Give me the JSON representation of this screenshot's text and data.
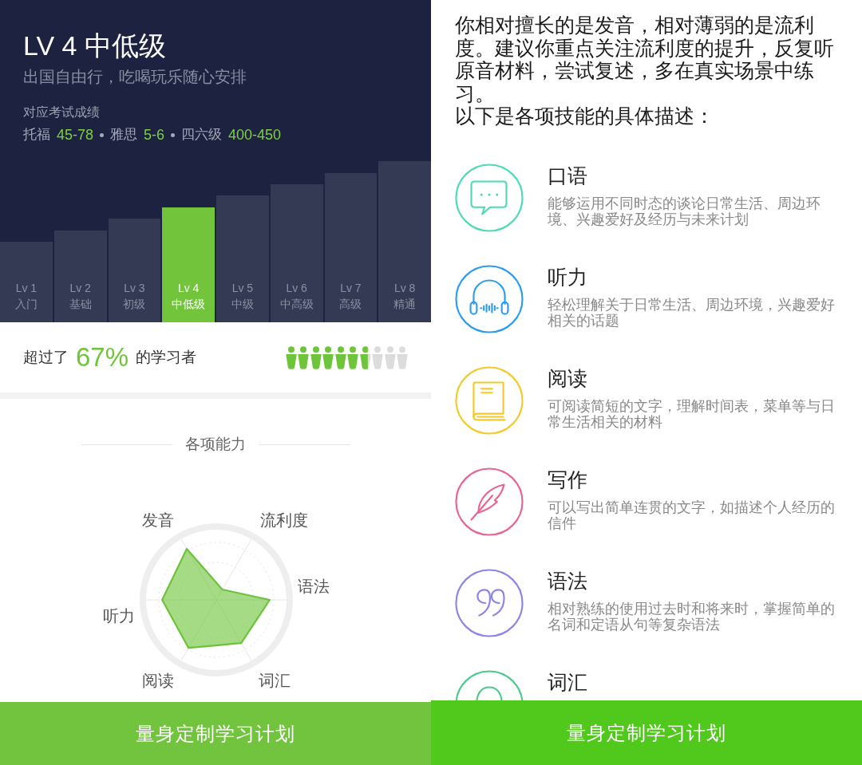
{
  "left": {
    "header": {
      "title": "LV 4 中低级",
      "subtitle": "出国自由行，吃喝玩乐随心安排",
      "exam_label": "对应考试成绩",
      "exam_scores": [
        {
          "exam": "托福",
          "score": "45-78"
        },
        {
          "exam": "雅思",
          "score": "5-6"
        },
        {
          "exam": "四六级",
          "score": "400-450"
        }
      ]
    },
    "levels": [
      {
        "label": "Lv 1",
        "name": "入门",
        "selected": false
      },
      {
        "label": "Lv 2",
        "name": "基础",
        "selected": false
      },
      {
        "label": "Lv 3",
        "name": "初级",
        "selected": false
      },
      {
        "label": "Lv 4",
        "name": "中低级",
        "selected": true
      },
      {
        "label": "Lv 5",
        "name": "中级",
        "selected": false
      },
      {
        "label": "Lv 6",
        "name": "中高级",
        "selected": false
      },
      {
        "label": "Lv 7",
        "name": "高级",
        "selected": false
      },
      {
        "label": "Lv 8",
        "name": "精通",
        "selected": false
      }
    ],
    "percentile": {
      "prefix": "超过了",
      "value": "67%",
      "suffix": "的学习者",
      "stars": 6.7
    },
    "abilities": {
      "title": "各项能力",
      "axes": [
        {
          "label": "发音"
        },
        {
          "label": "流利度"
        },
        {
          "label": "语法"
        },
        {
          "label": "词汇"
        },
        {
          "label": "阅读"
        },
        {
          "label": "听力"
        }
      ]
    },
    "button": {
      "label": "量身定制学习计划"
    }
  },
  "right": {
    "paragraphs": [
      "你相对擅长的是发音，相对薄弱的是流利度。建议你重点关注流利度的提升，反复听原音材料，尝试复述，多在真实场景中练习。",
      "以下是各项技能的具体描述："
    ],
    "skills": [
      {
        "kind": "chat",
        "title": "口语",
        "description": "能够运用不同时态的谈论日常生活、周边环境、兴趣爱好及经历与未来计划",
        "color": "#4fd9b6"
      },
      {
        "kind": "headphones",
        "title": "听力",
        "description": "轻松理解关于日常生活、周边环境，兴趣爱好相关的话题",
        "color": "#2d9cf0"
      },
      {
        "kind": "book",
        "title": "阅读",
        "description": "可阅读简短的文字，理解时间表，菜单等与日常生活相关的材料",
        "color": "#f4c92b"
      },
      {
        "kind": "feather",
        "title": "写作",
        "description": "可以写出简单连贯的文字，如描述个人经历的信件",
        "color": "#e9648f"
      },
      {
        "kind": "quote",
        "title": "语法",
        "description": "相对熟练的使用过去时和将来时，掌握简单的名词和定语从句等复杂语法",
        "color": "#8a85e6"
      },
      {
        "kind": "ring",
        "title": "词汇",
        "color": "#4ccb8c"
      }
    ],
    "button": {
      "label": "量身定制学习计划"
    }
  }
}
